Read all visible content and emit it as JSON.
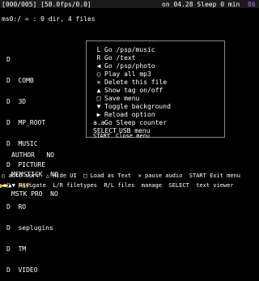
{
  "header": {
    "counter": "[000/005] [58.0fps/0.0]",
    "time": "on 04.28 Sleep 0 min",
    "battery": "86"
  },
  "path": "ms0:/ = : 0 dir, 4 files",
  "files": [
    {
      "label": "D",
      "selected": false
    },
    {
      "label": "D  COMB",
      "selected": false
    },
    {
      "label": "D  3D",
      "selected": false
    },
    {
      "label": "D  MP_ROOT",
      "selected": false
    },
    {
      "label": "D  MUSIC",
      "selected": false
    },
    {
      "label": "D  PICTURE",
      "selected": false
    },
    {
      "label": "D  PSP",
      "selected": true
    },
    {
      "label": "D  RO",
      "selected": false
    },
    {
      "label": "D  seplugins",
      "selected": false
    },
    {
      "label": "D  TM",
      "selected": false
    },
    {
      "label": "D  VIDEO",
      "selected": false
    }
  ],
  "info": [
    "AUTHOR   NO",
    "MEMSTICK  NO",
    "MSTK PRO  NO"
  ],
  "menu": {
    "items": [
      {
        "icon": "L",
        "label": "Go /psp/music"
      },
      {
        "icon": "R",
        "label": "Go /text"
      },
      {
        "icon": "◀",
        "label": "Go /psp/photo"
      },
      {
        "icon": "○",
        "label": "Play all mp3"
      },
      {
        "icon": "✕",
        "label": "Delete this file"
      },
      {
        "icon": "▲",
        "label": "Show tag on/off"
      },
      {
        "icon": "□",
        "label": "Save menu"
      },
      {
        "icon": "▼",
        "label": "Toggle background"
      },
      {
        "icon": "▶",
        "label": "Reload option"
      },
      {
        "icon": "a.a",
        "label": "Go Sleep counter"
      },
      {
        "icon": "SELECT",
        "label": "USB menu"
      },
      {
        "icon": "START",
        "label": "Close menu"
      }
    ]
  },
  "footer": {
    "line1": "○ auto sort  △ Hide UI  □ Load as Text  ✕ pause audio  START Exit menu",
    "line2": "◀▶▲▼ Navigate  L/R filetypes  R/L files  manage  SELECT  text viewer"
  }
}
